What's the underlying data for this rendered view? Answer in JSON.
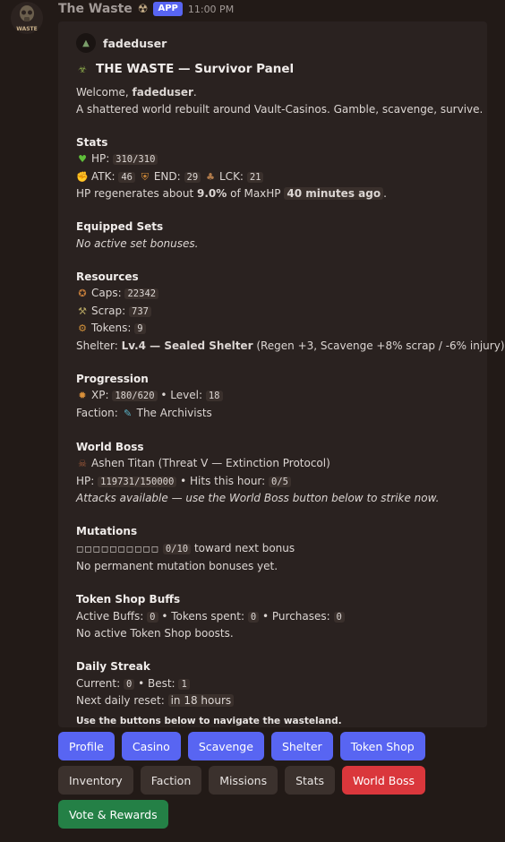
{
  "message": {
    "bot_name": "The Waste",
    "badge": "APP",
    "timestamp": "11:00 PM",
    "avatar_text": "WASTE"
  },
  "embed": {
    "author": "fadeduser",
    "title": "THE WASTE — Survivor Panel",
    "welcome_prefix": "Welcome, ",
    "welcome_user": "fadeduser",
    "welcome_suffix": ".",
    "intro": "A shattered world rebuilt around Vault-Casinos. Gamble, scavenge, survive.",
    "stats": {
      "heading": "Stats",
      "hp_label": "HP:",
      "hp_value": "310/310",
      "atk_label": "ATK:",
      "atk_value": "46",
      "end_label": "END:",
      "end_value": "29",
      "lck_label": "LCK:",
      "lck_value": "21",
      "regen_prefix": "HP regenerates about ",
      "regen_pct": "9.0%",
      "regen_mid": " of MaxHP ",
      "regen_time": "40 minutes ago",
      "regen_suffix": "."
    },
    "equipped": {
      "heading": "Equipped Sets",
      "text": "No active set bonuses."
    },
    "resources": {
      "heading": "Resources",
      "caps_label": "Caps:",
      "caps_value": "22342",
      "scrap_label": "Scrap:",
      "scrap_value": "737",
      "tokens_label": "Tokens:",
      "tokens_value": "9",
      "shelter_label": "Shelter: ",
      "shelter_value": "Lv.4 — Sealed Shelter",
      "shelter_detail": " (Regen +3, Scavenge +8% scrap / -6% injury)"
    },
    "progression": {
      "heading": "Progression",
      "xp_label": "XP:",
      "xp_value": "180/620",
      "level_label": " • Level:",
      "level_value": "18",
      "faction_label": "Faction:",
      "faction_value": "The Archivists"
    },
    "world_boss": {
      "heading": "World Boss",
      "name": "Ashen Titan (Threat V — Extinction Protocol)",
      "hp_label": "HP:",
      "hp_value": "119731/150000",
      "hits_label": " • Hits this hour:",
      "hits_value": "0/5",
      "note": "Attacks available — use the World Boss button below to strike now."
    },
    "mutations": {
      "heading": "Mutations",
      "boxes": "◻◻◻◻◻◻◻◻◻◻",
      "progress": "0/10",
      "progress_suffix": " toward next bonus",
      "text": "No permanent mutation bonuses yet."
    },
    "token_shop": {
      "heading": "Token Shop Buffs",
      "active_label": "Active Buffs:",
      "active_value": "0",
      "spent_label": " • Tokens spent:",
      "spent_value": "0",
      "purchases_label": " • Purchases:",
      "purchases_value": "0",
      "text": "No active Token Shop boosts."
    },
    "daily": {
      "heading": "Daily Streak",
      "current_label": "Current:",
      "current_value": "0",
      "best_label": " • Best:",
      "best_value": "1",
      "reset_label": "Next daily reset:",
      "reset_value": "in 18 hours"
    },
    "footer": "Use the buttons below to navigate the wasteland."
  },
  "buttons": {
    "row1": [
      "Profile",
      "Casino",
      "Scavenge",
      "Shelter",
      "Token Shop"
    ],
    "row2": [
      "Inventory",
      "Faction",
      "Missions",
      "Stats",
      "World Boss"
    ],
    "row3": [
      "Vote & Rewards"
    ]
  },
  "colors": {
    "background": "#221a17",
    "embed": "#2a2220",
    "primary": "#5865f2",
    "secondary": "#3b312d",
    "danger": "#da373c",
    "success": "#248046"
  }
}
